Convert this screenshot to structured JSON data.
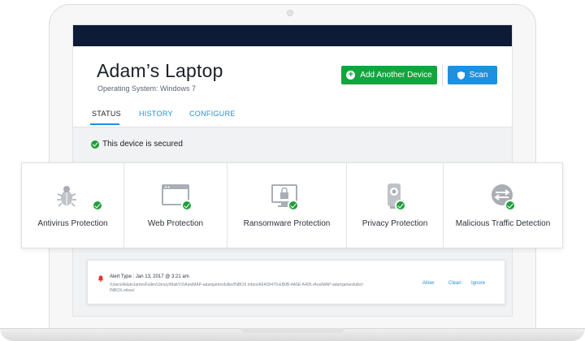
{
  "device": {
    "title": "Adam’s Laptop",
    "os_label": "Operating System: Windows 7"
  },
  "actions": {
    "add_device": "Add Another Device",
    "scan": "Scan"
  },
  "tabs": [
    {
      "label": "STATUS",
      "active": true
    },
    {
      "label": "HISTORY",
      "active": false
    },
    {
      "label": "CONFIGURE",
      "active": false
    }
  ],
  "status": {
    "message": "This device is secured"
  },
  "protections": [
    {
      "label": "Antivirus Protection",
      "icon": "bug-icon"
    },
    {
      "label": "Web Protection",
      "icon": "browser-window-icon"
    },
    {
      "label": "Ransomware Protection",
      "icon": "monitor-lock-icon"
    },
    {
      "label": "Privacy Protection",
      "icon": "webcam-icon"
    },
    {
      "label": "Malicious Traffic Detection",
      "icon": "traffic-arrows-icon"
    }
  ],
  "alert": {
    "type_line": "Alert Type : Jan 13, 2017 @ 3:21 am",
    "path_line1": "/Users/AdamJamesFuller/Library/Mail/V2/AosIMAP-adamjamesfuller/INBOX.mbox/AFA00479-EB0B-4A6E-A405-/AosIMAP-adamjamesfuller/",
    "path_line2": "INBOX.mbox/",
    "allow": "Allow",
    "clean": "Clean",
    "ignore": "Ignore"
  },
  "colors": {
    "top_bar": "#0e1b36",
    "add_button": "#13a53d",
    "scan_button": "#1f8fe0",
    "link": "#1f8fe0",
    "secured_check": "#1ea03a",
    "alert_icon": "#e3342f"
  }
}
